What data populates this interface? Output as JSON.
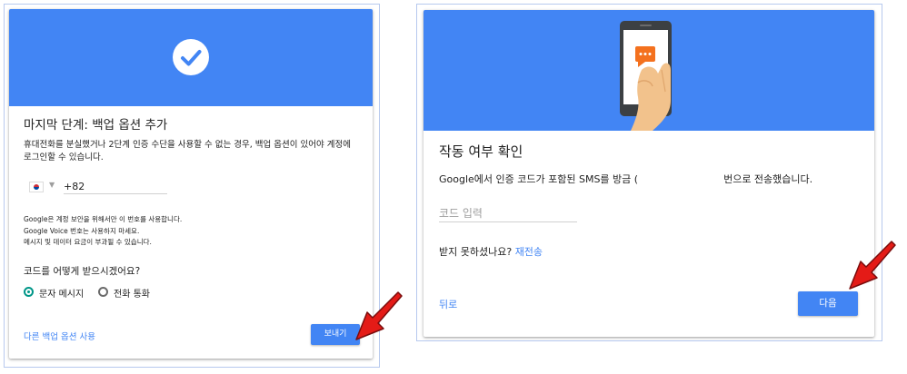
{
  "left_card": {
    "title": "마지막 단계: 백업 옵션 추가",
    "description": "휴대전화를 분실했거나 2단계 인증 수단을 사용할 수 없는 경우, 백업 옵션이 있어야 계정에 로그인할 수 있습니다.",
    "phone_value": "+82",
    "country": "KR",
    "note_lines": [
      "Google은 계정 보안을 위해서만 이 번호를 사용합니다.",
      "Google Voice 번호는 사용하지 마세요.",
      "메시지 및 데이터 요금이 부과될 수 있습니다."
    ],
    "question": "코드를 어떻게 받으시겠어요?",
    "radio_options": [
      {
        "label": "문자 메시지",
        "selected": true
      },
      {
        "label": "전화 통화",
        "selected": false
      }
    ],
    "other_option_link": "다른 백업 옵션 사용",
    "send_button": "보내기"
  },
  "right_card": {
    "title": "작동 여부 확인",
    "description_before": "Google에서 인증 코드가 포함된 SMS를 방금 (",
    "description_after": "번으로 전송했습니다.",
    "code_placeholder": "코드 입력",
    "not_received": "받지 못하셨나요?",
    "resend_link": "재전송",
    "back_link": "뒤로",
    "next_button": "다음"
  },
  "colors": {
    "brand_blue": "#4285f4",
    "radio_teal": "#009688",
    "arrow_red": "#e41b17"
  },
  "icons": {
    "left_hero": "check-circle-icon",
    "right_hero": "phone-sms-illustration",
    "pointer": "red-arrow-icon"
  }
}
